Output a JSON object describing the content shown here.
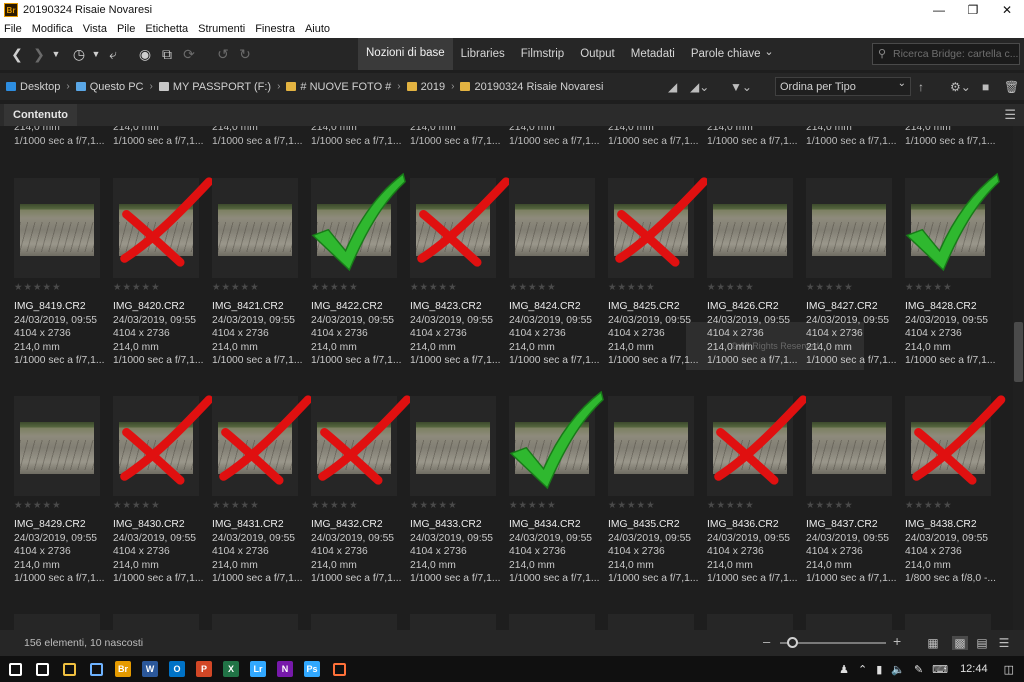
{
  "window": {
    "title": "20190324 Risaie Novaresi",
    "app_icon": "Br",
    "controls": [
      "minimize-icon",
      "restore-icon",
      "close-icon"
    ]
  },
  "menu": [
    "File",
    "Modifica",
    "Vista",
    "Pile",
    "Etichetta",
    "Strumenti",
    "Finestra",
    "Aiuto"
  ],
  "toolbar": {
    "left_icons": [
      "back-icon",
      "forward-icon",
      "chevron-down-icon",
      "history-icon",
      "boomerang-icon",
      "camera-icon",
      "refine-icon",
      "rotate-sync-icon",
      "rotate-ccw-icon",
      "rotate-cw-icon"
    ],
    "workspaces": [
      "Nozioni di base",
      "Libraries",
      "Filmstrip",
      "Output",
      "Metadati",
      "Parole chiave"
    ],
    "active_workspace": "Nozioni di base",
    "search_placeholder": "Ricerca Bridge: cartella c..."
  },
  "path": [
    {
      "label": "Desktop",
      "icon": "desktop-icon",
      "color": "#2d8de0"
    },
    {
      "label": "Questo PC",
      "icon": "pc-icon",
      "color": "#5aa7e6"
    },
    {
      "label": "MY PASSPORT (F:)",
      "icon": "drive-icon",
      "color": "#c8c8c8"
    },
    {
      "label": "# NUOVE FOTO #",
      "icon": "folder-icon",
      "color": "#e3b341"
    },
    {
      "label": "2019",
      "icon": "folder-icon",
      "color": "#e3b341"
    },
    {
      "label": "20190324 Risaie Novaresi",
      "icon": "folder-icon",
      "color": "#e3b341"
    }
  ],
  "sort": {
    "label": "Ordina per Tipo"
  },
  "panel": {
    "tab": "Contenuto"
  },
  "partial_top": [
    {
      "line1": "214,0 mm",
      "line2": "1/1000 sec a f/7,1..."
    },
    {
      "line1": "214,0 mm",
      "line2": "1/1000 sec a f/7,1..."
    },
    {
      "line1": "214,0 mm",
      "line2": "1/1000 sec a f/7,1..."
    },
    {
      "line1": "214,0 mm",
      "line2": "1/1000 sec a f/7,1..."
    },
    {
      "line1": "214,0 mm",
      "line2": "1/1000 sec a f/7,1..."
    },
    {
      "line1": "214,0 mm",
      "line2": "1/1000 sec a f/7,1..."
    },
    {
      "line1": "214,0 mm",
      "line2": "1/1000 sec a f/7,1..."
    },
    {
      "line1": "214,0 mm",
      "line2": "1/1000 sec a f/7,1..."
    },
    {
      "line1": "214,0 mm",
      "line2": "1/1000 sec a f/7,1..."
    },
    {
      "line1": "214,0 mm",
      "line2": "1/1000 sec a f/7,1..."
    }
  ],
  "row1": [
    {
      "name": "IMG_8419.CR2",
      "date": "24/03/2019, 09:55",
      "dims": "4104 x 2736",
      "focal": "214,0 mm",
      "exposure": "1/1000 sec a f/7,1...",
      "mark": ""
    },
    {
      "name": "IMG_8420.CR2",
      "date": "24/03/2019, 09:55",
      "dims": "4104 x 2736",
      "focal": "214,0 mm",
      "exposure": "1/1000 sec a f/7,1...",
      "mark": "reject"
    },
    {
      "name": "IMG_8421.CR2",
      "date": "24/03/2019, 09:55",
      "dims": "4104 x 2736",
      "focal": "214,0 mm",
      "exposure": "1/1000 sec a f/7,1...",
      "mark": ""
    },
    {
      "name": "IMG_8422.CR2",
      "date": "24/03/2019, 09:55",
      "dims": "4104 x 2736",
      "focal": "214,0 mm",
      "exposure": "1/1000 sec a f/7,1...",
      "mark": "accept"
    },
    {
      "name": "IMG_8423.CR2",
      "date": "24/03/2019, 09:55",
      "dims": "4104 x 2736",
      "focal": "214,0 mm",
      "exposure": "1/1000 sec a f/7,1...",
      "mark": "reject"
    },
    {
      "name": "IMG_8424.CR2",
      "date": "24/03/2019, 09:55",
      "dims": "4104 x 2736",
      "focal": "214,0 mm",
      "exposure": "1/1000 sec a f/7,1...",
      "mark": ""
    },
    {
      "name": "IMG_8425.CR2",
      "date": "24/03/2019, 09:55",
      "dims": "4104 x 2736",
      "focal": "214,0 mm",
      "exposure": "1/1000 sec a f/7,1...",
      "mark": "reject"
    },
    {
      "name": "IMG_8426.CR2",
      "date": "24/03/2019, 09:55",
      "dims": "4104 x 2736",
      "focal": "214,0 mm",
      "exposure": "1/1000 sec a f/7,1...",
      "mark": ""
    },
    {
      "name": "IMG_8427.CR2",
      "date": "24/03/2019, 09:55",
      "dims": "4104 x 2736",
      "focal": "214,0 mm",
      "exposure": "1/1000 sec a f/7,1...",
      "mark": ""
    },
    {
      "name": "IMG_8428.CR2",
      "date": "24/03/2019, 09:55",
      "dims": "4104 x 2736",
      "focal": "214,0 mm",
      "exposure": "1/1000 sec a f/7,1...",
      "mark": "accept"
    }
  ],
  "row2": [
    {
      "name": "IMG_8429.CR2",
      "date": "24/03/2019, 09:55",
      "dims": "4104 x 2736",
      "focal": "214,0 mm",
      "exposure": "1/1000 sec a f/7,1...",
      "mark": ""
    },
    {
      "name": "IMG_8430.CR2",
      "date": "24/03/2019, 09:55",
      "dims": "4104 x 2736",
      "focal": "214,0 mm",
      "exposure": "1/1000 sec a f/7,1...",
      "mark": "reject"
    },
    {
      "name": "IMG_8431.CR2",
      "date": "24/03/2019, 09:55",
      "dims": "4104 x 2736",
      "focal": "214,0 mm",
      "exposure": "1/1000 sec a f/7,1...",
      "mark": "reject"
    },
    {
      "name": "IMG_8432.CR2",
      "date": "24/03/2019, 09:55",
      "dims": "4104 x 2736",
      "focal": "214,0 mm",
      "exposure": "1/1000 sec a f/7,1...",
      "mark": "reject"
    },
    {
      "name": "IMG_8433.CR2",
      "date": "24/03/2019, 09:55",
      "dims": "4104 x 2736",
      "focal": "214,0 mm",
      "exposure": "1/1000 sec a f/7,1...",
      "mark": ""
    },
    {
      "name": "IMG_8434.CR2",
      "date": "24/03/2019, 09:55",
      "dims": "4104 x 2736",
      "focal": "214,0 mm",
      "exposure": "1/1000 sec a f/7,1...",
      "mark": "accept"
    },
    {
      "name": "IMG_8435.CR2",
      "date": "24/03/2019, 09:55",
      "dims": "4104 x 2736",
      "focal": "214,0 mm",
      "exposure": "1/1000 sec a f/7,1...",
      "mark": ""
    },
    {
      "name": "IMG_8436.CR2",
      "date": "24/03/2019, 09:55",
      "dims": "4104 x 2736",
      "focal": "214,0 mm",
      "exposure": "1/1000 sec a f/7,1...",
      "mark": "reject"
    },
    {
      "name": "IMG_8437.CR2",
      "date": "24/03/2019, 09:55",
      "dims": "4104 x 2736",
      "focal": "214,0 mm",
      "exposure": "1/1000 sec a f/7,1...",
      "mark": ""
    },
    {
      "name": "IMG_8438.CR2",
      "date": "24/03/2019, 09:55",
      "dims": "4104 x 2736",
      "focal": "214,0 mm",
      "exposure": "1/800 sec a f/8,0 -...",
      "mark": "reject"
    }
  ],
  "rating_stars": "★★★★★",
  "status": {
    "count_text": "156 elementi, 10 nascosti",
    "zoom_level": 0.08
  },
  "colors": {
    "accept": "#2fb82f",
    "reject": "#e01010",
    "background": "#1e1e1e"
  },
  "taskbar": {
    "apps": [
      {
        "icon": "start-icon",
        "label": "",
        "color": "#ffffff"
      },
      {
        "icon": "task-view-icon",
        "label": "",
        "color": "#ffffff"
      },
      {
        "icon": "file-explorer-icon",
        "label": "",
        "color": "#f0c040"
      },
      {
        "icon": "paint-icon",
        "label": "",
        "color": "#6fb3ff"
      },
      {
        "icon": "bridge-icon",
        "label": "Br",
        "color": "#e59a00"
      },
      {
        "icon": "word-icon",
        "label": "W",
        "color": "#2b579a"
      },
      {
        "icon": "outlook-icon",
        "label": "O",
        "color": "#0072c6"
      },
      {
        "icon": "powerpoint-icon",
        "label": "P",
        "color": "#d24726"
      },
      {
        "icon": "excel-icon",
        "label": "X",
        "color": "#217346"
      },
      {
        "icon": "lightroom-icon",
        "label": "Lr",
        "color": "#31a8ff"
      },
      {
        "icon": "onenote-icon",
        "label": "N",
        "color": "#7719aa"
      },
      {
        "icon": "photoshop-icon",
        "label": "Ps",
        "color": "#31a8ff"
      },
      {
        "icon": "firefox-icon",
        "label": "",
        "color": "#ff7139"
      }
    ],
    "time": "12:44"
  }
}
